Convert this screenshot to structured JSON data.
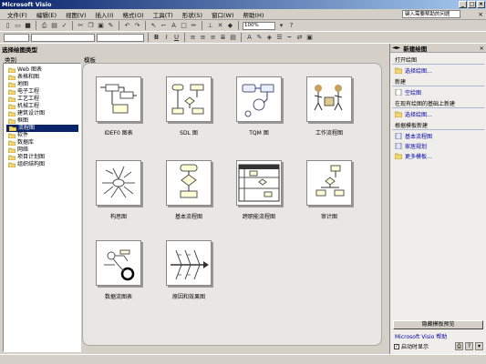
{
  "window": {
    "title": "Microsoft Visio"
  },
  "menu": {
    "items": [
      "文件(F)",
      "编辑(E)",
      "视图(V)",
      "插入(I)",
      "格式(O)",
      "工具(T)",
      "形状(S)",
      "窗口(W)",
      "帮助(H)"
    ],
    "help_placeholder": "键入需要帮助的问题"
  },
  "toolbar": {
    "zoom": "100%"
  },
  "left_panel": {
    "title": "选择绘图类型",
    "category_label": "类别",
    "template_label": "模板",
    "categories": [
      "Web 图表",
      "表格和图",
      "地图",
      "电子工程",
      "工艺工程",
      "机械工程",
      "建筑设计图",
      "框图",
      "流程图",
      "软件",
      "数据库",
      "网络",
      "项目计划图",
      "组织结构图"
    ],
    "selected_category": "流程图",
    "templates": [
      "IDEF0 图表",
      "SDL 图",
      "TQM 图",
      "工作流程图",
      "构思图",
      "基本流程图",
      "跨职能流程图",
      "审计图",
      "数据流图表",
      "原因和效果图"
    ]
  },
  "task_pane": {
    "title": "新建绘图",
    "sections": [
      {
        "heading": "打开绘图",
        "links": [
          "选择绘图..."
        ]
      },
      {
        "heading": "新建",
        "links": [
          "空绘图"
        ]
      },
      {
        "heading": "在现有绘图的基础上新建",
        "links": [
          "选择绘图..."
        ]
      },
      {
        "heading": "根据模板新建",
        "links": [
          "基本流程图",
          "家居规划",
          "更多模板..."
        ]
      }
    ],
    "hide_preview_button": "隐藏模板预览",
    "help_link": "Microsoft Visio 帮助",
    "startup_label": "启动时显示"
  },
  "colors": {
    "title_start": "#0a246a",
    "title_end": "#a6caf0",
    "chrome": "#d4d0c8",
    "selection": "#0a246a",
    "link": "#0000aa",
    "folder": "#f5d66a"
  }
}
